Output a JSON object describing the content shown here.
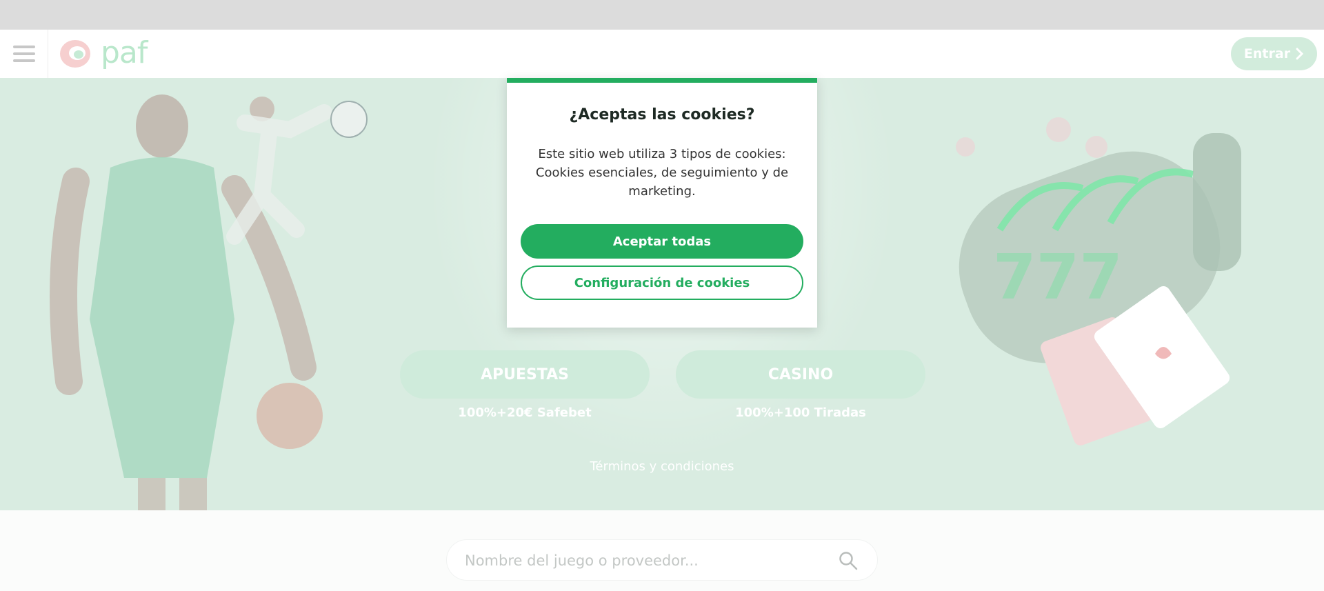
{
  "header": {
    "menu_icon": "hamburger-icon",
    "logo_text": "paf",
    "login_label": "Entrar",
    "login_icon": "chevron-right-icon"
  },
  "hero": {
    "buttons": [
      {
        "label": "APUESTAS",
        "subtitle": "100%+20€ Safebet"
      },
      {
        "label": "CASINO",
        "subtitle": "100%+100 Tiradas"
      }
    ],
    "terms_link": "Términos y condiciones"
  },
  "search": {
    "placeholder": "Nombre del juego o proveedor...",
    "icon": "search-icon"
  },
  "cookie_modal": {
    "title": "¿Aceptas las cookies?",
    "body": "Este sitio web utiliza 3 tipos de cookies: Cookies esenciales, de seguimiento y de marketing.",
    "accept_label": "Aceptar todas",
    "config_label": "Configuración de cookies"
  },
  "colors": {
    "accent": "#23ad5f",
    "hero_bg": "#d9ece1",
    "logo_pink": "#f4c4c4",
    "logo_green": "#b9e7cb"
  }
}
